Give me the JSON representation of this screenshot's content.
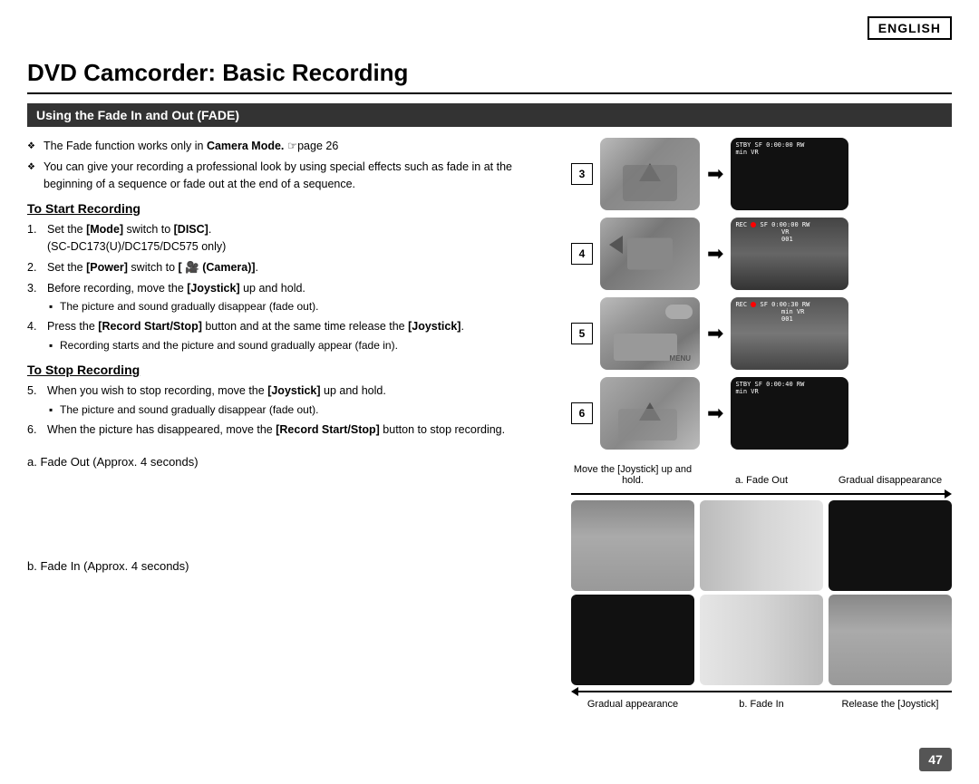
{
  "header": {
    "english_label": "ENGLISH"
  },
  "title": "DVD Camcorder: Basic Recording",
  "section": {
    "header": "Using the Fade In and Out (FADE)"
  },
  "intro_bullets": [
    "The Fade function works only in Camera Mode. ☞page 26",
    "You can give your recording a professional look by using special effects such as fade in at the beginning of a sequence or fade out at the end of a sequence."
  ],
  "start_recording": {
    "title": "To Start Recording",
    "steps": [
      {
        "num": 1,
        "text": "Set the [Mode] switch to [DISC]. (SC-DC173(U)/DC175/DC575 only)"
      },
      {
        "num": 2,
        "text": "Set the [Power] switch to [ 🎥 (Camera)]."
      },
      {
        "num": 3,
        "text": "Before recording, move the [Joystick] up and hold.",
        "sub": "The picture and sound gradually disappear (fade out)."
      },
      {
        "num": 4,
        "text": "Press the [Record Start/Stop] button and at the same time release the [Joystick].",
        "sub": "Recording starts and the picture and sound gradually appear (fade in)."
      }
    ]
  },
  "stop_recording": {
    "title": "To Stop Recording",
    "steps": [
      {
        "num": 5,
        "text": "When you wish to stop recording, move the [Joystick] up and hold.",
        "sub": "The picture and sound gradually disappear (fade out)."
      },
      {
        "num": 6,
        "text": "When the picture has disappeared, move the [Record Start/Stop] button to stop recording."
      }
    ]
  },
  "fade_examples": {
    "a_label": "a. Fade Out (Approx. 4 seconds)",
    "b_label": "b. Fade In (Approx. 4 seconds)"
  },
  "diagram": {
    "top_labels": [
      "Move the [Joystick] up and hold.",
      "a. Fade Out",
      "Gradual disappearance"
    ],
    "bottom_labels": [
      "Gradual appearance",
      "b. Fade In",
      "Release the [Joystick]"
    ]
  },
  "steps_right": [
    {
      "num": "3",
      "screen_mode": "STBY",
      "screen_info": "STBY SF 0:00:00 RW\nmin VR"
    },
    {
      "num": "4",
      "screen_mode": "REC",
      "screen_info": "REC ● SF 0:00:00 RW\nVR\n001"
    },
    {
      "num": "5",
      "screen_mode": "REC",
      "screen_info": "REC ● SF 0:00:30 RW\nmin VR\n001"
    },
    {
      "num": "6",
      "screen_mode": "STBY",
      "screen_info": "STBY SF 0:00:40 RW\nmin VR"
    }
  ],
  "page_number": "47"
}
